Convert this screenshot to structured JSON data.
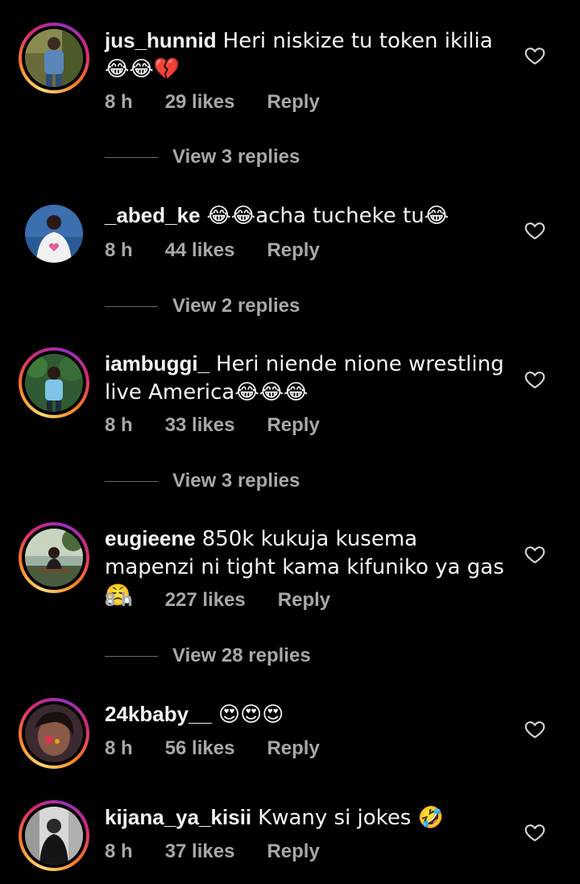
{
  "theme": {
    "background": "#000000",
    "text_primary": "#f5f5f5",
    "text_secondary": "#a8a8a8",
    "story_ring": [
      "#feda75",
      "#fa7e1e",
      "#d62976",
      "#962fbf"
    ]
  },
  "comments": [
    {
      "username": "jus_hunnid",
      "text": "Heri niskize tu token ikilia😂😂💔",
      "time": "8 h",
      "likes": "29 likes",
      "reply_label": "Reply",
      "view_replies": "View 3 replies",
      "has_story_ring": true
    },
    {
      "username": "_abed_ke",
      "text": "😂😂acha tucheke tu😂",
      "time": "8 h",
      "likes": "44 likes",
      "reply_label": "Reply",
      "view_replies": "View 2 replies",
      "has_story_ring": false
    },
    {
      "username": "iambuggi_",
      "text": "Heri niende nione wrestling live America😂😂😂",
      "time": "8 h",
      "likes": "33 likes",
      "reply_label": "Reply",
      "view_replies": "View 3 replies",
      "has_story_ring": true
    },
    {
      "username": "eugieene",
      "text": "850k kukuja kusema mapenzi ni tight kama kifuniko ya gas 😤",
      "time": "8 h",
      "likes": "227 likes",
      "reply_label": "Reply",
      "view_replies": "View 28 replies",
      "has_story_ring": true
    },
    {
      "username": "24kbaby__",
      "text": "😍😍😍",
      "time": "8 h",
      "likes": "56 likes",
      "reply_label": "Reply",
      "has_story_ring": true
    },
    {
      "username": "kijana_ya_kisii",
      "text": "Kwany si jokes 🤣",
      "time": "8 h",
      "likes": "37 likes",
      "reply_label": "Reply",
      "has_story_ring": true
    }
  ]
}
